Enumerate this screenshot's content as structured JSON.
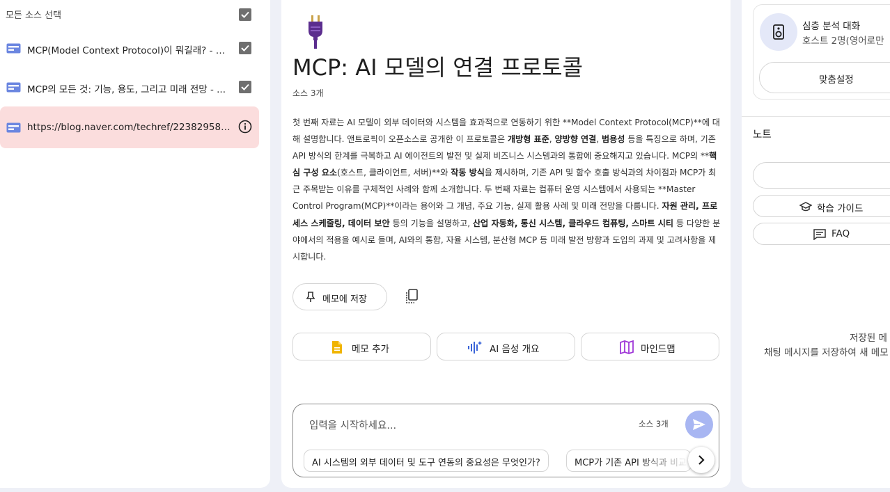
{
  "sources": {
    "select_all_label": "모든 소스 선택",
    "items": [
      {
        "title": "MCP(Model Context Protocol)이 뭐길래? - DE..."
      },
      {
        "title": "MCP의 모든 것: 기능, 용도, 그리고 미래 전망 - ..."
      },
      {
        "title": "https://blog.naver.com/techref/223829581241..."
      }
    ]
  },
  "notebook": {
    "title": "MCP: AI 모델의 연결 프로토콜",
    "source_count": "소스 3개",
    "summary": {
      "s1": "첫 번째 자료는 AI 모델이 외부 데이터와 시스템을 효과적으로 연동하기 위한 **Model Context Protocol(MCP)**에 대해 설명합니다. 앤트로픽이 오픈소스로 공개한 이 프로토콜은 ",
      "b1": "개방형 표준",
      "s2": ", ",
      "b2": "양방향 연결",
      "s3": ", ",
      "b3": "범용성",
      "s4": " 등을 특징으로 하며, 기존 API 방식의 한계를 극복하고 AI 에이전트의 발전 및 실제 비즈니스 시스템과의 통합에 중요해지고 있습니다. MCP의 **",
      "b4": "핵심 구성 요소",
      "s5": "(호스트, 클라이언트, 서버)**와 ",
      "b5": "작동 방식",
      "s6": "을 제시하며, 기존 API 및 함수 호출 방식과의 차이점과 MCP가 최근 주목받는 이유를 구체적인 사례와 함께 소개합니다. 두 번째 자료는 컴퓨터 운영 시스템에서 사용되는 **Master Control Program(MCP)**이라는 용어와 그 개념, 주요 기능, 실제 활용 사례 및 미래 전망을 다룹니다. ",
      "b6": "자원 관리, 프로세스 스케줄링, 데이터 보안",
      "s7": " 등의 기능을 설명하고, ",
      "b7": "산업 자동화, 통신 시스템, 클라우드 컴퓨팅, 스마트 시티",
      "s8": " 등 다양한 분야에서의 적용을 예시로 들며, AI와의 통합, 자율 시스템, 분산형 MCP 등 미래 발전 방향과 도입의 과제 및 고려사항을 제시합니다."
    },
    "save_to_note": "메모에 저장",
    "actions": {
      "add_note": "메모 추가",
      "audio_overview": "AI 음성 개요",
      "mind_map": "마인드맵"
    },
    "chat": {
      "placeholder": "입력을 시작하세요...",
      "source_count": "소스 3개",
      "suggestions": [
        "AI 시스템의 외부 데이터 및 도구 연동의 중요성은 무엇인가?",
        "MCP가 기존 API 방식과 비교"
      ]
    }
  },
  "studio": {
    "deep_dive_title": "심층 분석 대화",
    "deep_dive_sub": "호스트 2명(영어로만",
    "customize": "맞춤설정",
    "notes_heading": "노트",
    "study_guide": "학습 가이드",
    "faq": "FAQ",
    "empty_line1": "저장된 메",
    "empty_line2": "채팅 메시지를 저장하여 새 메모"
  },
  "colors": {
    "active_source_bg": "#fbdddd",
    "source_icon": "#6b86e0",
    "plug": "#5b2d8e",
    "note_icon": "#f0b400",
    "audio_icon": "#3a64d8",
    "mindmap_icon": "#a13ad8",
    "send_button": "#a8b6f2"
  }
}
